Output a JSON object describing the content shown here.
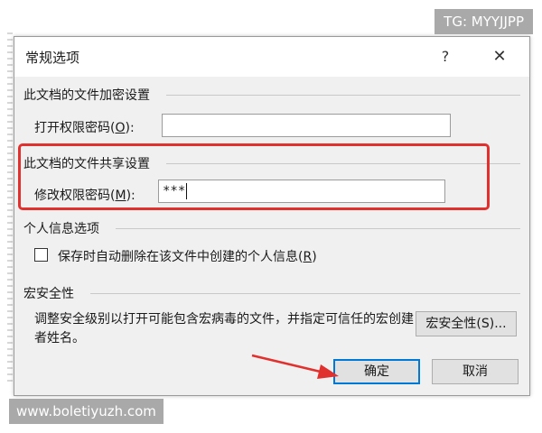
{
  "dialog": {
    "title": "常规选项",
    "help_icon": "?",
    "close_icon": "✕"
  },
  "encrypt": {
    "section_title": "此文档的文件加密设置",
    "open_password_label": "打开权限密码(",
    "open_password_key": "O",
    "open_password_suffix": "):",
    "open_password_value": ""
  },
  "share": {
    "section_title": "此文档的文件共享设置",
    "modify_password_label": "修改权限密码(",
    "modify_password_key": "M",
    "modify_password_suffix": "):",
    "modify_password_value": "***"
  },
  "privacy": {
    "section_title": "个人信息选项",
    "remove_info_label": "保存时自动删除在该文件中创建的个人信息(",
    "remove_info_key": "R",
    "remove_info_suffix": ")",
    "remove_info_checked": false
  },
  "macro": {
    "section_title": "宏安全性",
    "description": "调整安全级别以打开可能包含宏病毒的文件，并指定可信任的宏创建者姓名。",
    "button_label": "宏安全性(S)..."
  },
  "footer": {
    "ok_label": "确定",
    "cancel_label": "取消"
  },
  "watermarks": {
    "top": "TG: MYYJJPP",
    "bottom": "www.boletiyuzh.com"
  },
  "colors": {
    "highlight": "#e0312f",
    "arrow": "#e0312f",
    "default_button_border": "#0078d7"
  }
}
